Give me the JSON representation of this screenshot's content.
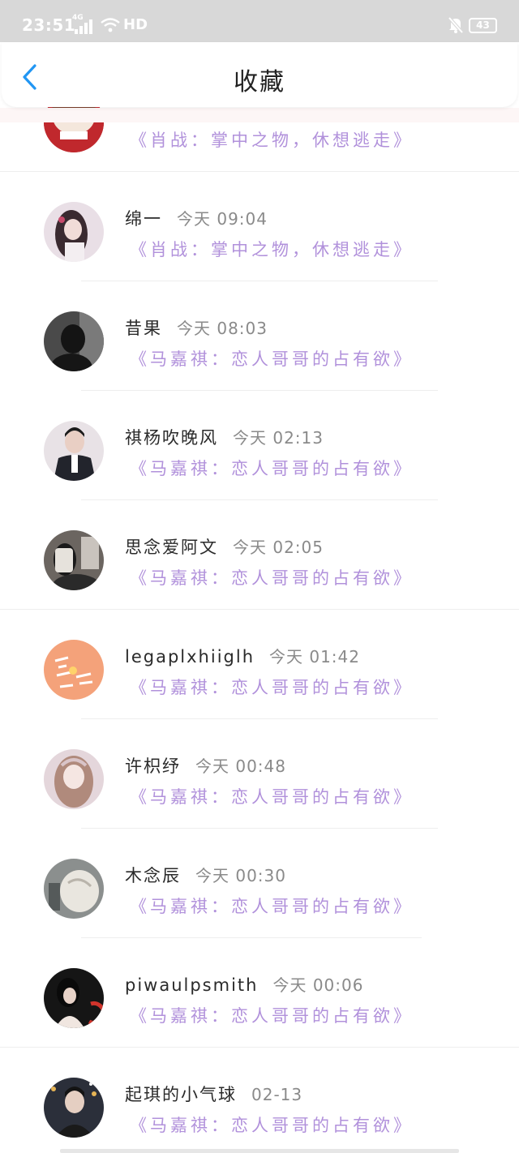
{
  "status": {
    "time": "23:51",
    "network": "4G",
    "hd": "HD",
    "battery": "43"
  },
  "header": {
    "title": "收藏"
  },
  "items": [
    {
      "name": "",
      "time": "",
      "work": "《肖战：掌中之物，休想逃走》",
      "avatar_color": "#c0282d"
    },
    {
      "name": "绵一",
      "time": "今天 09:04",
      "work": "《肖战：掌中之物，休想逃走》",
      "avatar_color": "#b58a9c"
    },
    {
      "name": "昔果",
      "time": "今天 08:03",
      "work": "《马嘉祺：恋人哥哥的占有欲》",
      "avatar_color": "#2e2e2e"
    },
    {
      "name": "祺杨吹晚风",
      "time": "今天 02:13",
      "work": "《马嘉祺：恋人哥哥的占有欲》",
      "avatar_color": "#3a3d4a"
    },
    {
      "name": "思念爱阿文",
      "time": "今天 02:05",
      "work": "《马嘉祺：恋人哥哥的占有欲》",
      "avatar_color": "#4a4542"
    },
    {
      "name": "legaplxhiiglh",
      "time": "今天 01:42",
      "work": "《马嘉祺：恋人哥哥的占有欲》",
      "avatar_color": "#f4a27a"
    },
    {
      "name": "许枳纾",
      "time": "今天 00:48",
      "work": "《马嘉祺：恋人哥哥的占有欲》",
      "avatar_color": "#d9c4c8"
    },
    {
      "name": "木念辰",
      "time": "今天 00:30",
      "work": "《马嘉祺：恋人哥哥的占有欲》",
      "avatar_color": "#8b8f8e"
    },
    {
      "name": "piwaulpsmith",
      "time": "今天 00:06",
      "work": "《马嘉祺：恋人哥哥的占有欲》",
      "avatar_color": "#151515"
    },
    {
      "name": "起琪的小气球",
      "time": "02-13",
      "work": "《马嘉祺：恋人哥哥的占有欲》",
      "avatar_color": "#2b2f3a"
    }
  ]
}
